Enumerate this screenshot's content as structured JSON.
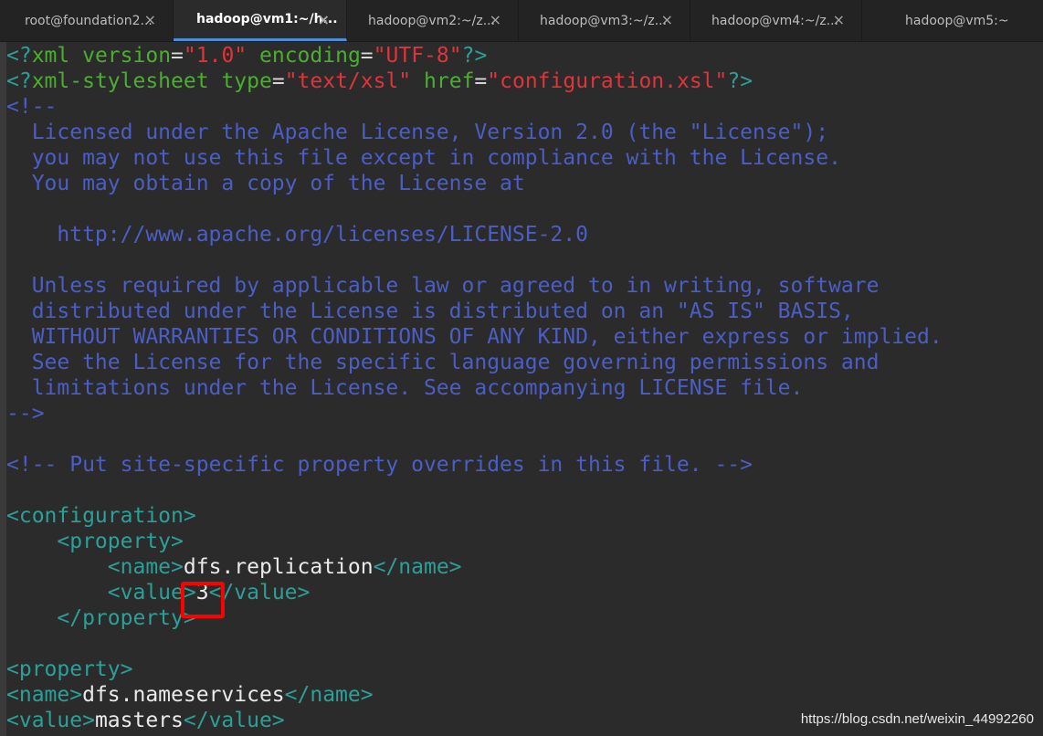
{
  "tabs": [
    {
      "label": "root@foundation2...",
      "active": false
    },
    {
      "label": "hadoop@vm1:~/h...",
      "active": true
    },
    {
      "label": "hadoop@vm2:~/z...",
      "active": false
    },
    {
      "label": "hadoop@vm3:~/z...",
      "active": false
    },
    {
      "label": "hadoop@vm4:~/z...",
      "active": false
    },
    {
      "label": "hadoop@vm5:~",
      "active": false
    }
  ],
  "close_glyph": "×",
  "editor": {
    "lines": [
      [
        [
          "pun",
          "<?"
        ],
        [
          "attr",
          "xml"
        ],
        [
          "dflt",
          " "
        ],
        [
          "attr",
          "version"
        ],
        [
          "dflt",
          "="
        ],
        [
          "str",
          "\"1.0\""
        ],
        [
          "dflt",
          " "
        ],
        [
          "attr",
          "encoding"
        ],
        [
          "dflt",
          "="
        ],
        [
          "str",
          "\"UTF-8\""
        ],
        [
          "pun",
          "?>"
        ]
      ],
      [
        [
          "pun",
          "<?"
        ],
        [
          "attr",
          "xml-stylesheet"
        ],
        [
          "dflt",
          " "
        ],
        [
          "attr",
          "type"
        ],
        [
          "dflt",
          "="
        ],
        [
          "str",
          "\"text/xsl\""
        ],
        [
          "dflt",
          " "
        ],
        [
          "attr",
          "href"
        ],
        [
          "dflt",
          "="
        ],
        [
          "str",
          "\"configuration.xsl\""
        ],
        [
          "pun",
          "?>"
        ]
      ],
      [
        [
          "com",
          "<!--"
        ]
      ],
      [
        [
          "com",
          "  Licensed under the Apache License, Version 2.0 (the \"License\");"
        ]
      ],
      [
        [
          "com",
          "  you may not use this file except in compliance with the License."
        ]
      ],
      [
        [
          "com",
          "  You may obtain a copy of the License at"
        ]
      ],
      [
        [
          "com",
          ""
        ]
      ],
      [
        [
          "com",
          "    http://www.apache.org/licenses/LICENSE-2.0"
        ]
      ],
      [
        [
          "com",
          ""
        ]
      ],
      [
        [
          "com",
          "  Unless required by applicable law or agreed to in writing, software"
        ]
      ],
      [
        [
          "com",
          "  distributed under the License is distributed on an \"AS IS\" BASIS,"
        ]
      ],
      [
        [
          "com",
          "  WITHOUT WARRANTIES OR CONDITIONS OF ANY KIND, either express or implied."
        ]
      ],
      [
        [
          "com",
          "  See the License for the specific language governing permissions and"
        ]
      ],
      [
        [
          "com",
          "  limitations under the License. See accompanying LICENSE file."
        ]
      ],
      [
        [
          "com",
          "-->"
        ]
      ],
      [
        [
          "dflt",
          ""
        ]
      ],
      [
        [
          "com",
          "<!-- Put site-specific property overrides in this file. -->"
        ]
      ],
      [
        [
          "dflt",
          ""
        ]
      ],
      [
        [
          "tag",
          "<configuration>"
        ]
      ],
      [
        [
          "dflt",
          "    "
        ],
        [
          "tag",
          "<property>"
        ]
      ],
      [
        [
          "dflt",
          "        "
        ],
        [
          "tag",
          "<name>"
        ],
        [
          "txt",
          "dfs.replication"
        ],
        [
          "tag",
          "</name>"
        ]
      ],
      [
        [
          "dflt",
          "        "
        ],
        [
          "tag",
          "<value>"
        ],
        [
          "txt",
          "3"
        ],
        [
          "tag",
          "</value>"
        ]
      ],
      [
        [
          "dflt",
          "    "
        ],
        [
          "tag",
          "</property>"
        ]
      ],
      [
        [
          "dflt",
          ""
        ]
      ],
      [
        [
          "tag",
          "<property>"
        ]
      ],
      [
        [
          "tag",
          "<name>"
        ],
        [
          "txt",
          "dfs.nameservices"
        ],
        [
          "tag",
          "</name>"
        ]
      ],
      [
        [
          "tag",
          "<value>"
        ],
        [
          "txt",
          "masters"
        ],
        [
          "tag",
          "</value>"
        ]
      ]
    ]
  },
  "watermark": "https://blog.csdn.net/weixin_44992260",
  "colors": {
    "tag": "#2aa198",
    "attr": "#4cae2f",
    "string": "#e0343a",
    "comment": "#4b5ec5",
    "text": "#eaeaea",
    "highlight": "#ff0000",
    "active_tab_underline": "#4a90d9"
  }
}
